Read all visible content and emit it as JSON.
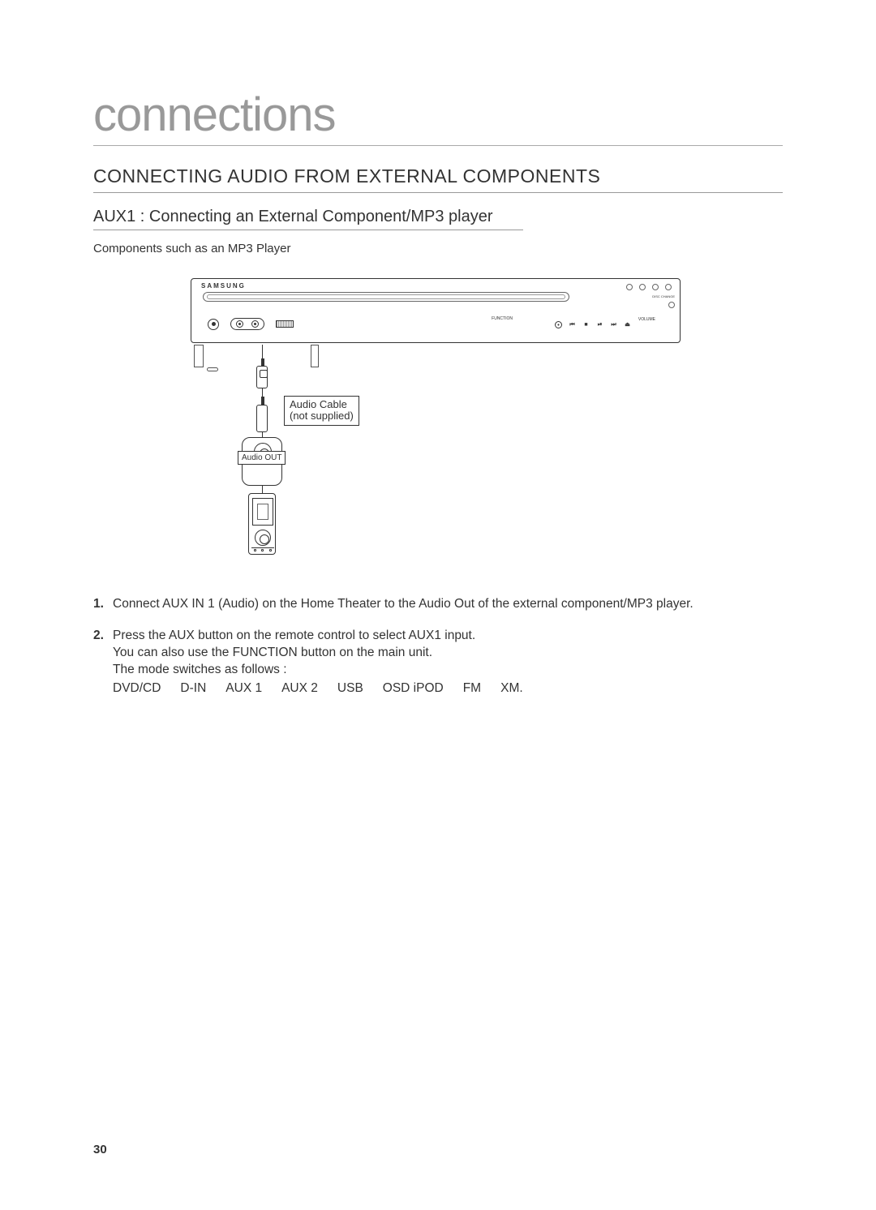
{
  "chapter_title": "connections",
  "section_title": "CONNECTING AUDIO FROM EXTERNAL COMPONENTS",
  "subsection_title": "AUX1 : Connecting an External Component/MP3 player",
  "intro_text": "Components such as an MP3 Player",
  "device": {
    "brand": "SAMSUNG",
    "function_label": "FUNCTION",
    "volume_label": "VOLUME",
    "disc_change_label": "DISC CHANGE"
  },
  "labels": {
    "audio_cable_line1": "Audio Cable",
    "audio_cable_line2": "(not supplied)",
    "audio_out": "Audio OUT"
  },
  "steps": [
    {
      "num": "1.",
      "text": "Connect AUX IN 1 (Audio) on the Home Theater to the Audio Out of the external component/MP3 player."
    },
    {
      "num": "2.",
      "line1": "Press the AUX button on the remote control to select AUX1 input.",
      "line2": "You can also use the FUNCTION button on the main unit.",
      "line3": "The mode switches as follows :",
      "modes": [
        "DVD/CD",
        "D-IN",
        "AUX 1",
        "AUX 2",
        "USB",
        "OSD iPOD",
        "FM",
        "XM."
      ]
    }
  ],
  "page_number": "30"
}
